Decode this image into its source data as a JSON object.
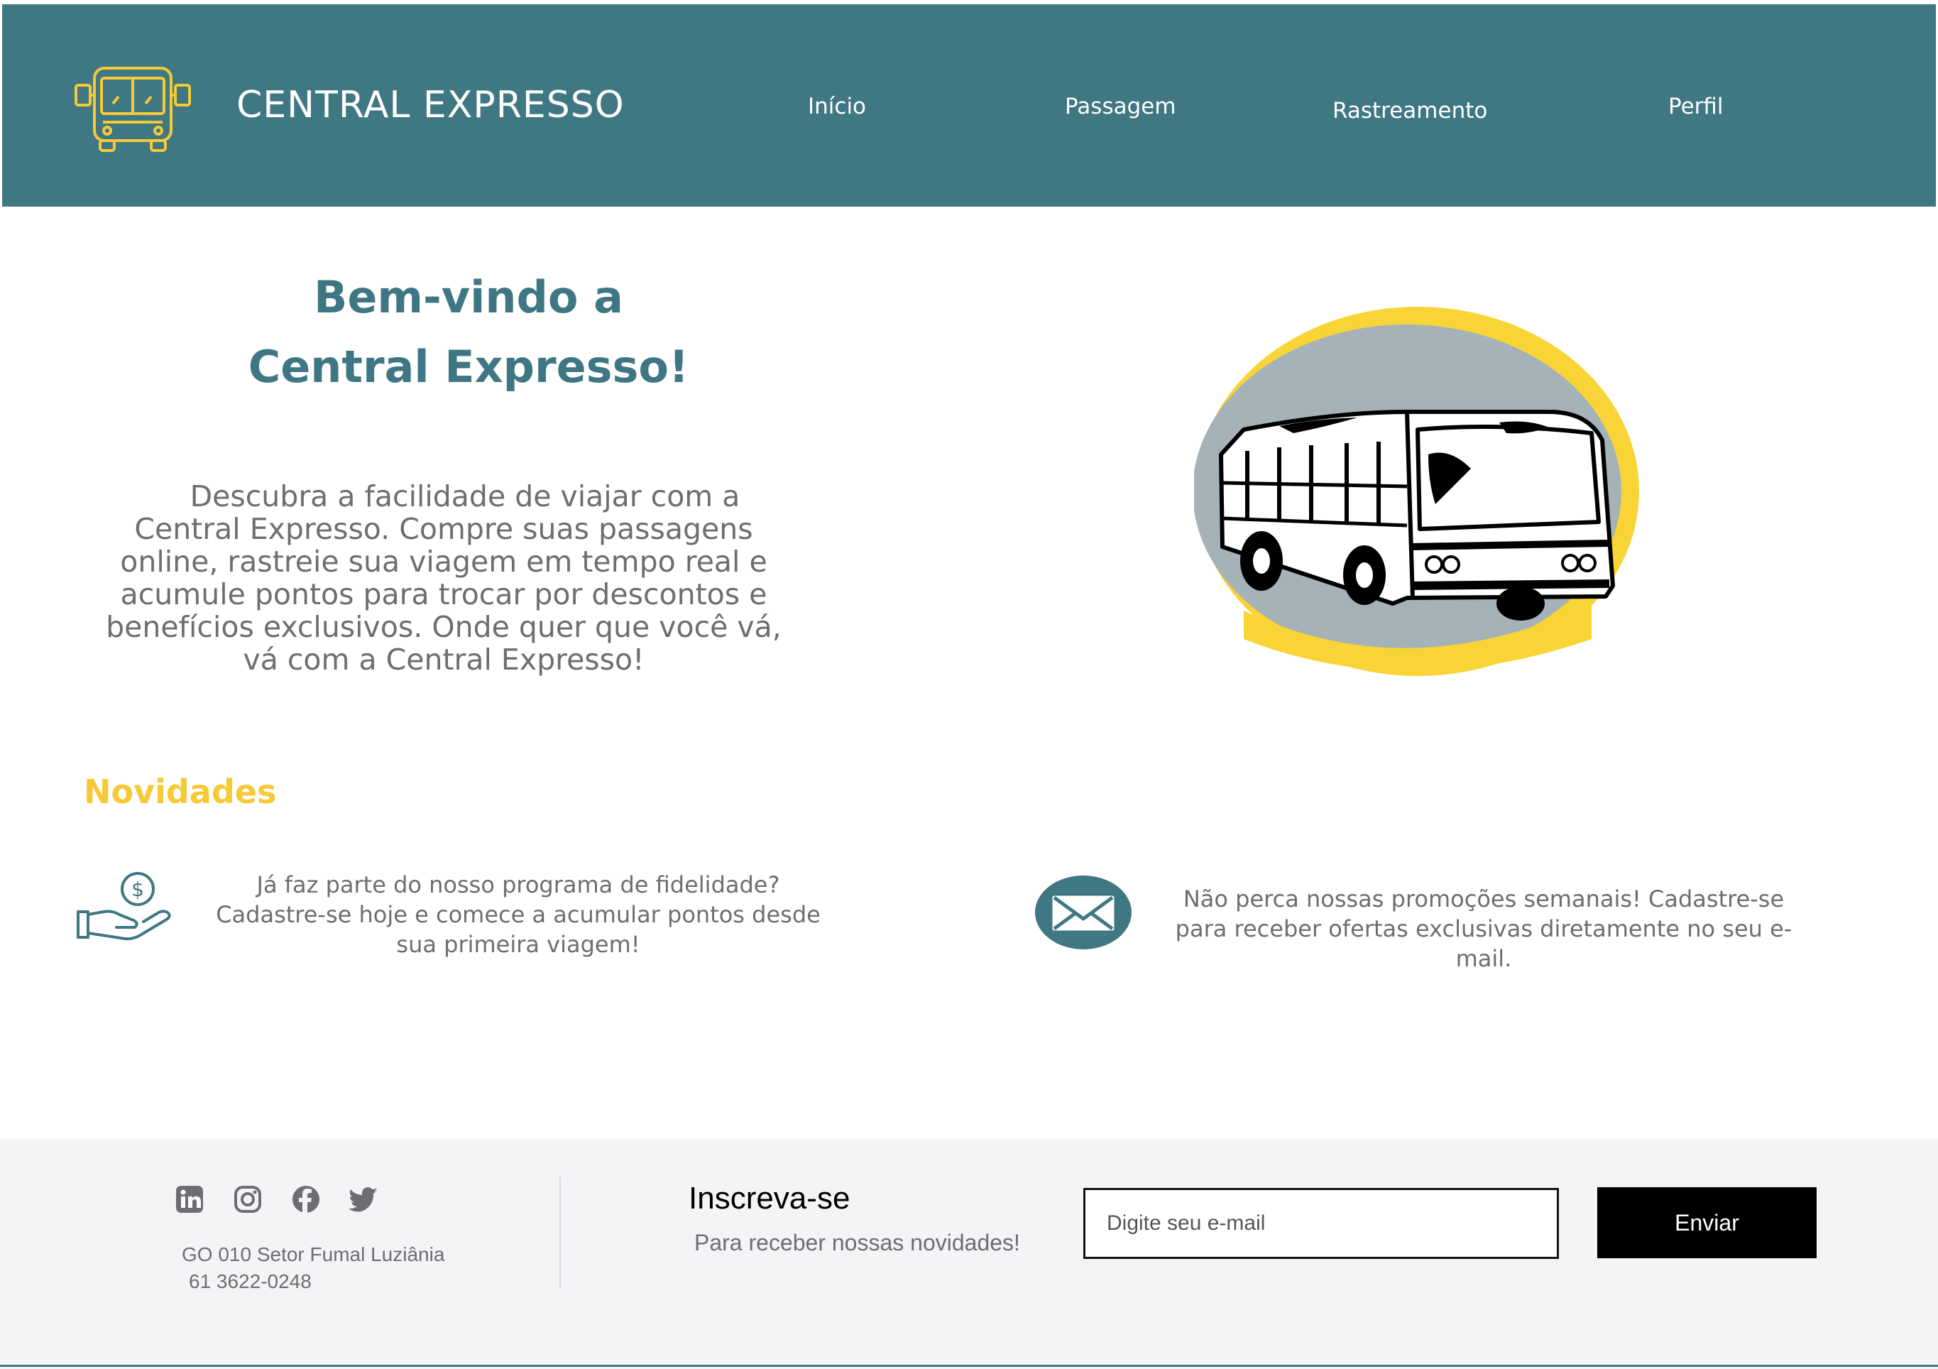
{
  "header": {
    "brand": "CENTRAL EXPRESSO",
    "logo_icon": "bus-outline-icon",
    "nav": [
      "Início",
      "Passagem",
      "Rastreamento",
      "Perfil"
    ]
  },
  "hero": {
    "title_line1": "Bem-vindo a",
    "title_line2": "Central Expresso!",
    "description": "Descubra a facilidade de viajar com a Central Expresso. Compre suas passagens online, rastreie sua viagem em tempo real e acumule pontos para trocar por descontos e benefícios exclusivos. Onde quer que você vá, vá com a Central Expresso!",
    "illustration": "bus-illustration"
  },
  "novidades": {
    "title": "Novidades",
    "items": [
      {
        "icon": "hand-money-icon",
        "text": "Já faz parte do nosso programa de fidelidade? Cadastre-se hoje e comece a acumular pontos desde sua primeira viagem!"
      },
      {
        "icon": "mail-icon",
        "text": "Não perca nossas promoções semanais! Cadastre-se para receber ofertas exclusivas diretamente no seu e-mail."
      }
    ]
  },
  "footer": {
    "social_icons": [
      "linkedin-icon",
      "instagram-icon",
      "facebook-icon",
      "twitter-icon"
    ],
    "address_line1": "GO 010 Setor Fumal Luziânia",
    "address_line2": "61 3622-0248",
    "subscribe_title": "Inscreva-se",
    "subscribe_subtitle": "Para receber nossas novidades!",
    "email_placeholder": "Digite seu e-mail",
    "send_label": "Enviar"
  },
  "colors": {
    "header_bg": "#3f7782",
    "accent_yellow": "#f6c936",
    "text_gray": "#6d6d72",
    "footer_bg": "#f3f4f6"
  }
}
